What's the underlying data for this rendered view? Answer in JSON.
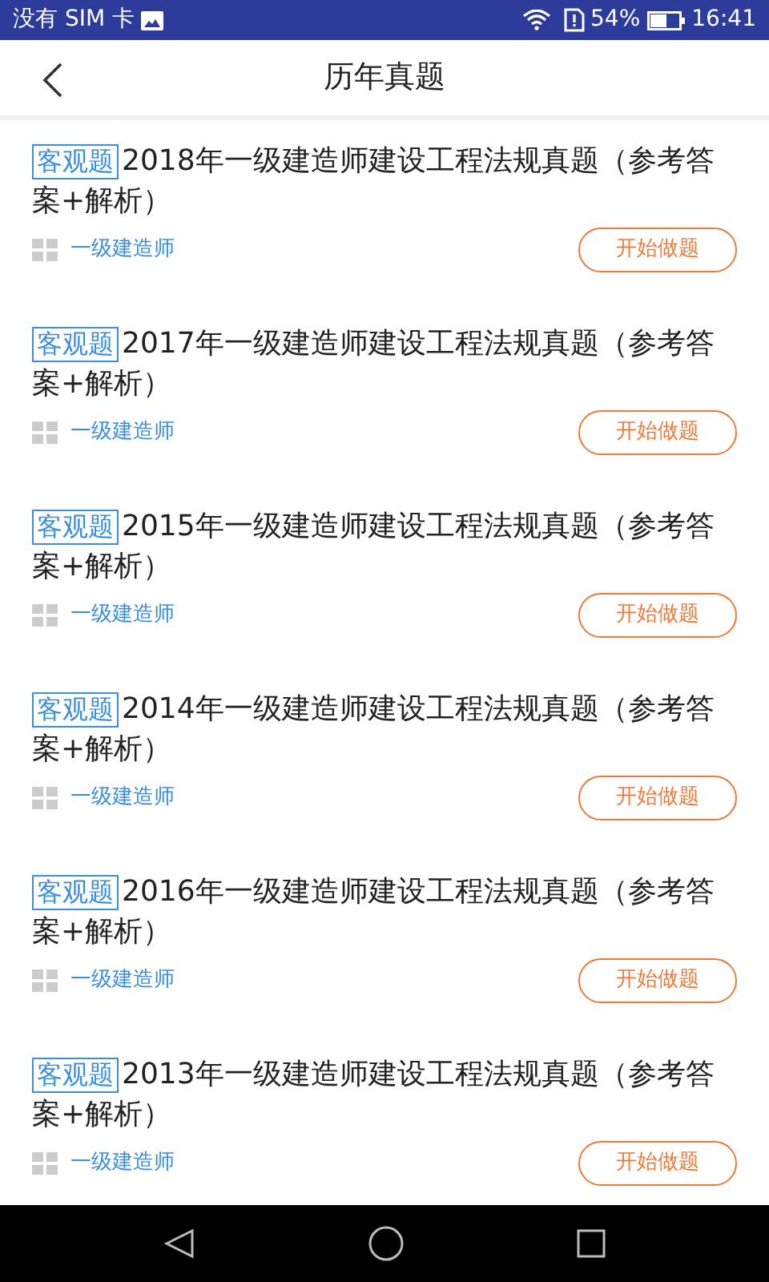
{
  "status_bar": {
    "carrier": "没有 SIM 卡",
    "battery": "54%",
    "time": "16:41"
  },
  "header": {
    "title": "历年真题"
  },
  "papers": [
    {
      "tag": "客观题",
      "title": "2018年一级建造师建设工程法规真题（参考答案+解析）",
      "category": "一级建造师",
      "action": "开始做题"
    },
    {
      "tag": "客观题",
      "title": "2017年一级建造师建设工程法规真题（参考答案+解析）",
      "category": "一级建造师",
      "action": "开始做题"
    },
    {
      "tag": "客观题",
      "title": "2015年一级建造师建设工程法规真题（参考答案+解析）",
      "category": "一级建造师",
      "action": "开始做题"
    },
    {
      "tag": "客观题",
      "title": "2014年一级建造师建设工程法规真题（参考答案+解析）",
      "category": "一级建造师",
      "action": "开始做题"
    },
    {
      "tag": "客观题",
      "title": "2016年一级建造师建设工程法规真题（参考答案+解析）",
      "category": "一级建造师",
      "action": "开始做题"
    },
    {
      "tag": "客观题",
      "title": "2013年一级建造师建设工程法规真题（参考答案+解析）",
      "category": "一级建造师",
      "action": "开始做题"
    }
  ]
}
